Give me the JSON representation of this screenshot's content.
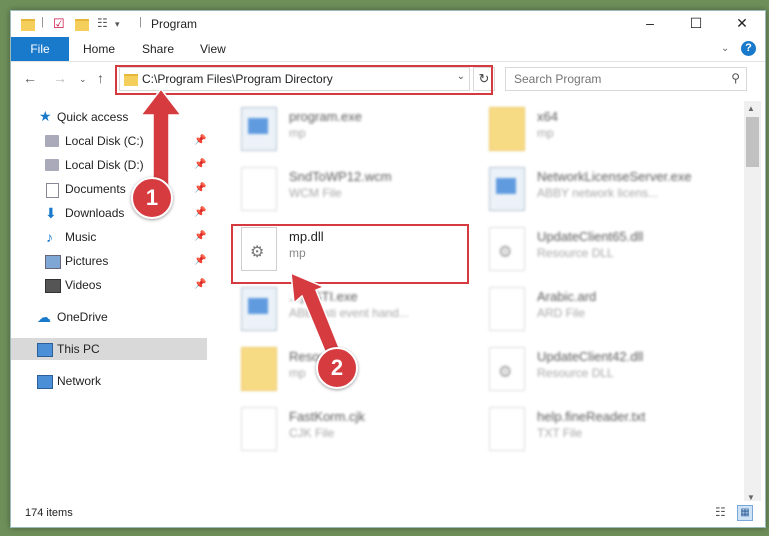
{
  "window": {
    "title": "Program"
  },
  "ribbon": {
    "tabs": [
      "File",
      "Home",
      "Share",
      "View"
    ]
  },
  "address": {
    "path": "C:\\Program Files\\Program Directory"
  },
  "search": {
    "placeholder": "Search Program"
  },
  "sidebar": {
    "quick_access": "Quick access",
    "items": [
      {
        "label": "Local Disk (C:)",
        "icon": "drive-icon",
        "pinned": true
      },
      {
        "label": "Local Disk (D:)",
        "icon": "drive-icon",
        "pinned": true
      },
      {
        "label": "Documents",
        "icon": "documents-icon",
        "pinned": true
      },
      {
        "label": "Downloads",
        "icon": "download-icon",
        "pinned": true
      },
      {
        "label": "Music",
        "icon": "music-icon",
        "pinned": true
      },
      {
        "label": "Pictures",
        "icon": "pictures-icon",
        "pinned": true
      },
      {
        "label": "Videos",
        "icon": "videos-icon",
        "pinned": true
      }
    ],
    "onedrive": "OneDrive",
    "this_pc": "This PC",
    "network": "Network"
  },
  "files": [
    {
      "name": "program.exe",
      "type": "mp"
    },
    {
      "name": "x64",
      "type": "mp"
    },
    {
      "name": "SndToWP12.wcm",
      "type": "WCM File"
    },
    {
      "name": "NetworkLicenseServer.exe",
      "type": "ABBY network licens..."
    },
    {
      "name": "mp.dll",
      "type": "mp"
    },
    {
      "name": "UpdateClient65.dll",
      "type": "Resource DLL"
    },
    {
      "name": "...yySTI.exe",
      "type": "ABBY sti event hand..."
    },
    {
      "name": "Arabic.ard",
      "type": "ARD File"
    },
    {
      "name": "Resou...",
      "type": "mp"
    },
    {
      "name": "UpdateClient42.dll",
      "type": "Resource DLL"
    },
    {
      "name": "FastKorm.cjk",
      "type": "CJK File"
    },
    {
      "name": "help.fineReader.txt",
      "type": "TXT File"
    }
  ],
  "status": {
    "count": "174 items"
  },
  "callouts": {
    "one": "1",
    "two": "2"
  },
  "colors": {
    "accent": "#1979ca",
    "highlight": "#d43a3f"
  }
}
